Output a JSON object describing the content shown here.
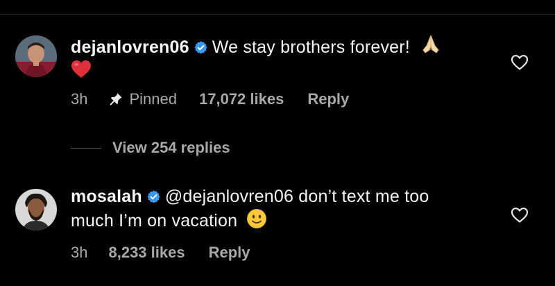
{
  "comments": [
    {
      "username": "dejanlovren06",
      "verified": true,
      "text": "We stay brothers forever!",
      "emojis": [
        "folded-hands-emoji",
        "red-heart-emoji"
      ],
      "time": "3h",
      "pinned_label": "Pinned",
      "likes": "17,072 likes",
      "reply_label": "Reply",
      "view_replies": "View 254 replies"
    },
    {
      "username": "mosalah",
      "verified": true,
      "text_line1": "@dejanlovren06 don’t text me too",
      "text_line2": "much I’m on vacation",
      "emojis": [
        "slightly-smiling-face-emoji"
      ],
      "time": "3h",
      "likes": "8,233 likes",
      "reply_label": "Reply"
    }
  ],
  "colors": {
    "background": "#000000",
    "primary_text": "#f5f5f5",
    "secondary_text": "#a8a8a8",
    "verified_blue": "#3897f0"
  },
  "icons": [
    "verified-badge-icon",
    "pin-icon",
    "heart-outline-icon"
  ]
}
